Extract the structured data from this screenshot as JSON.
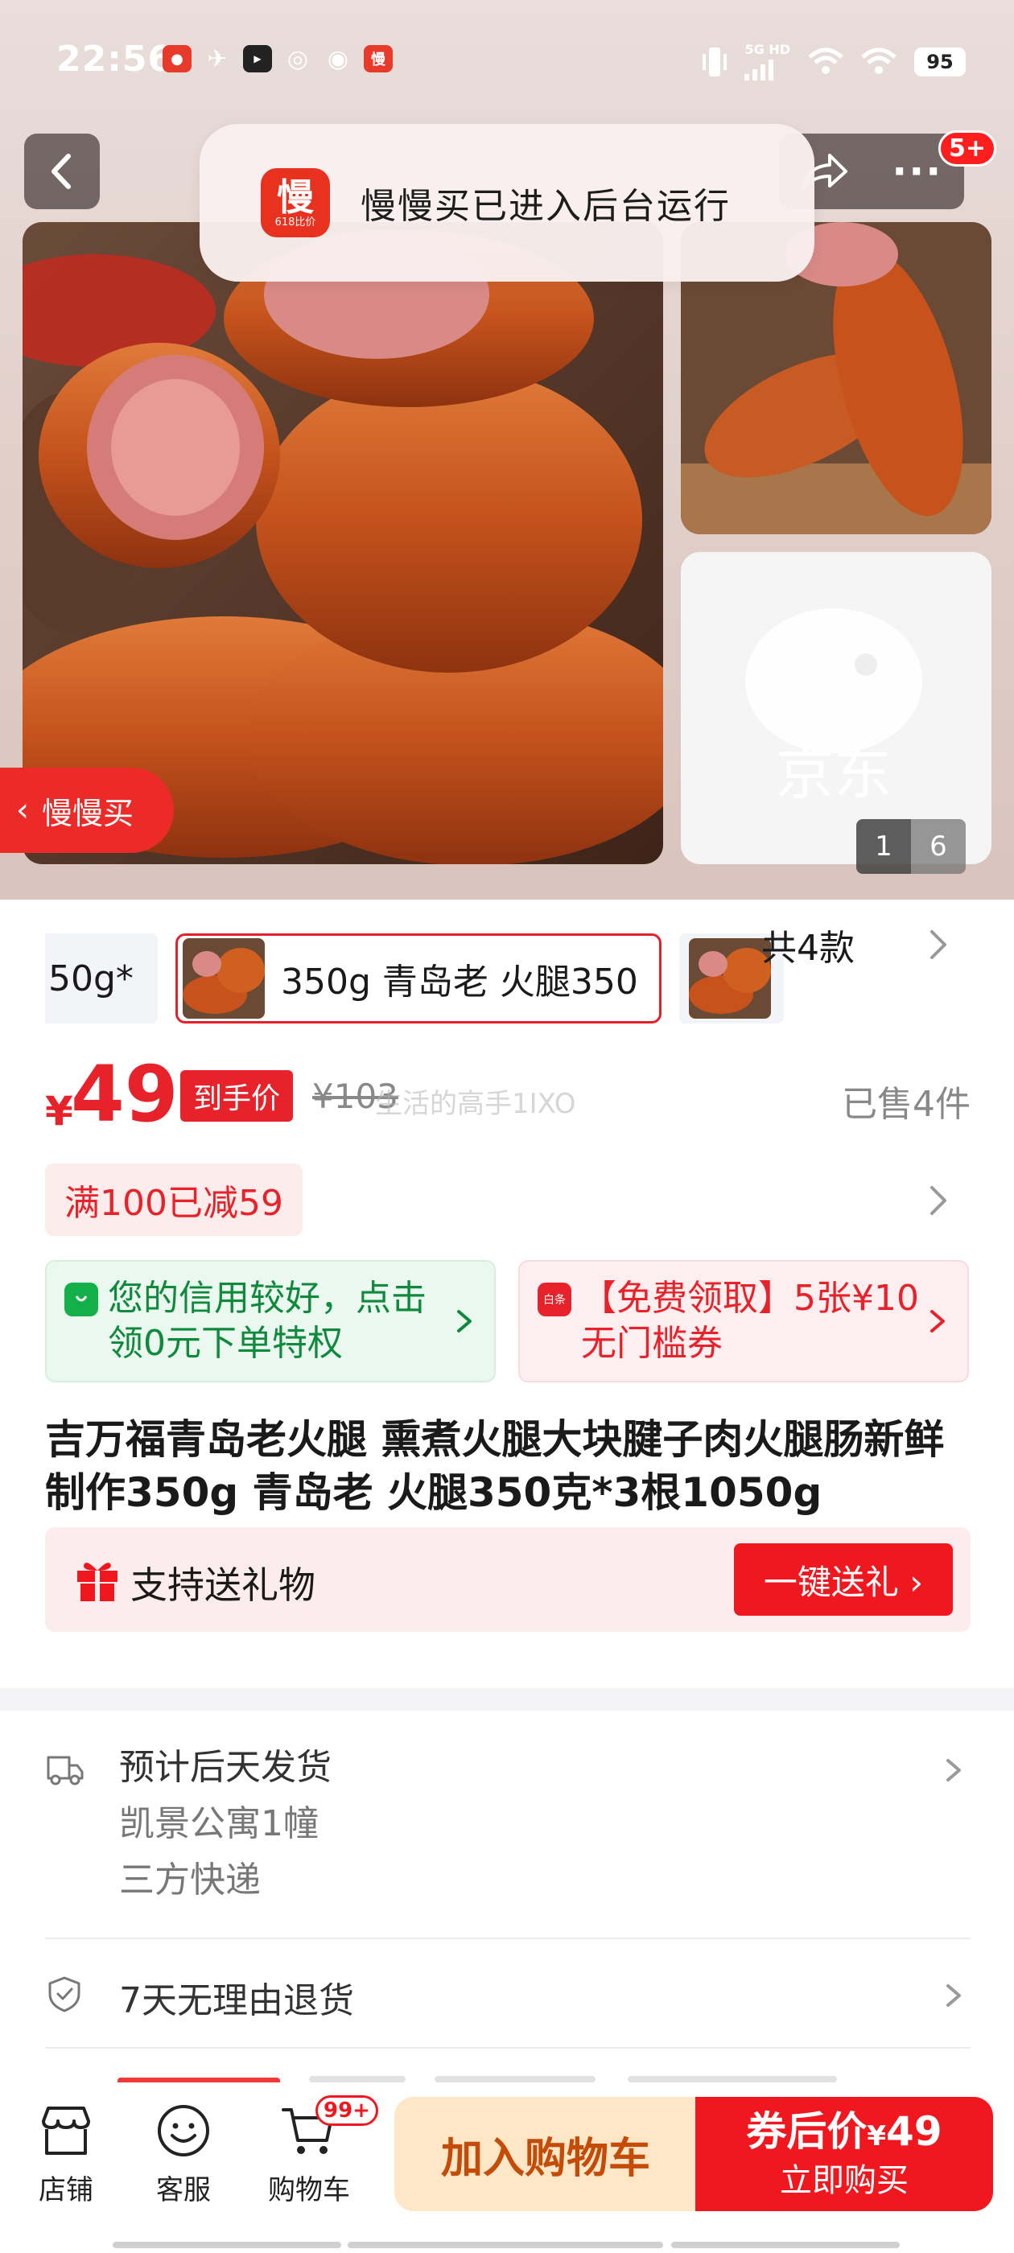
{
  "status_bar": {
    "time": "22:56",
    "network": "5G HD",
    "battery": "95",
    "notification_icons": [
      "app-red-icon",
      "bird-icon",
      "video-app-icon",
      "leaf-icon",
      "weibo-icon",
      "slow-buy-app-icon"
    ],
    "slow_buy_icon_char": "慢"
  },
  "nav": {
    "more_glyph": "···",
    "badge": "5+"
  },
  "toast": {
    "logo_char": "慢",
    "logo_sub": "618比价",
    "text": "慢慢买已进入后台运行"
  },
  "gallery": {
    "current": "1",
    "total": "6",
    "watermark": "京东"
  },
  "slow_buy_tag": "慢慢买",
  "variants": {
    "prev_cut_label": "50g*",
    "selected_label": "350g 青岛老 火腿350",
    "count_label": "共4款"
  },
  "price": {
    "currency": "¥",
    "amount": "49",
    "tag": "到手价",
    "original": "¥103",
    "watermark": "生活的高手1IXO",
    "sold": "已售4件"
  },
  "promo": "满100已减59",
  "cards": {
    "credit": "您的信用较好，点击领0元下单特权",
    "coupon_icon_text": "白条",
    "coupon": "【免费领取】5张¥10无门槛券"
  },
  "title": "吉万福青岛老火腿 熏煮火腿大块腱子肉火腿肠新鲜制作350g 青岛老 火腿350克*3根1050g",
  "gift": {
    "label": "支持送礼物",
    "button": "一键送礼 ›"
  },
  "shipping": {
    "main": "预计后天发货",
    "address": "凯景公寓1幢",
    "carrier": "三方快递"
  },
  "returns": "7天无理由退货",
  "bottom": {
    "shop": "店铺",
    "service": "客服",
    "cart": "购物车",
    "cart_badge": "99+",
    "add_to_cart": "加入购物车",
    "buy_prefix": "券后价",
    "buy_currency": "¥",
    "buy_price": "49",
    "buy_now": "立即购买"
  },
  "colors": {
    "accent_red": "#e8222a",
    "button_red": "#f0181e",
    "cart_button_bg": "#fde7c6",
    "cart_button_text": "#c54b09",
    "credit_green": "#0f8a3c"
  }
}
